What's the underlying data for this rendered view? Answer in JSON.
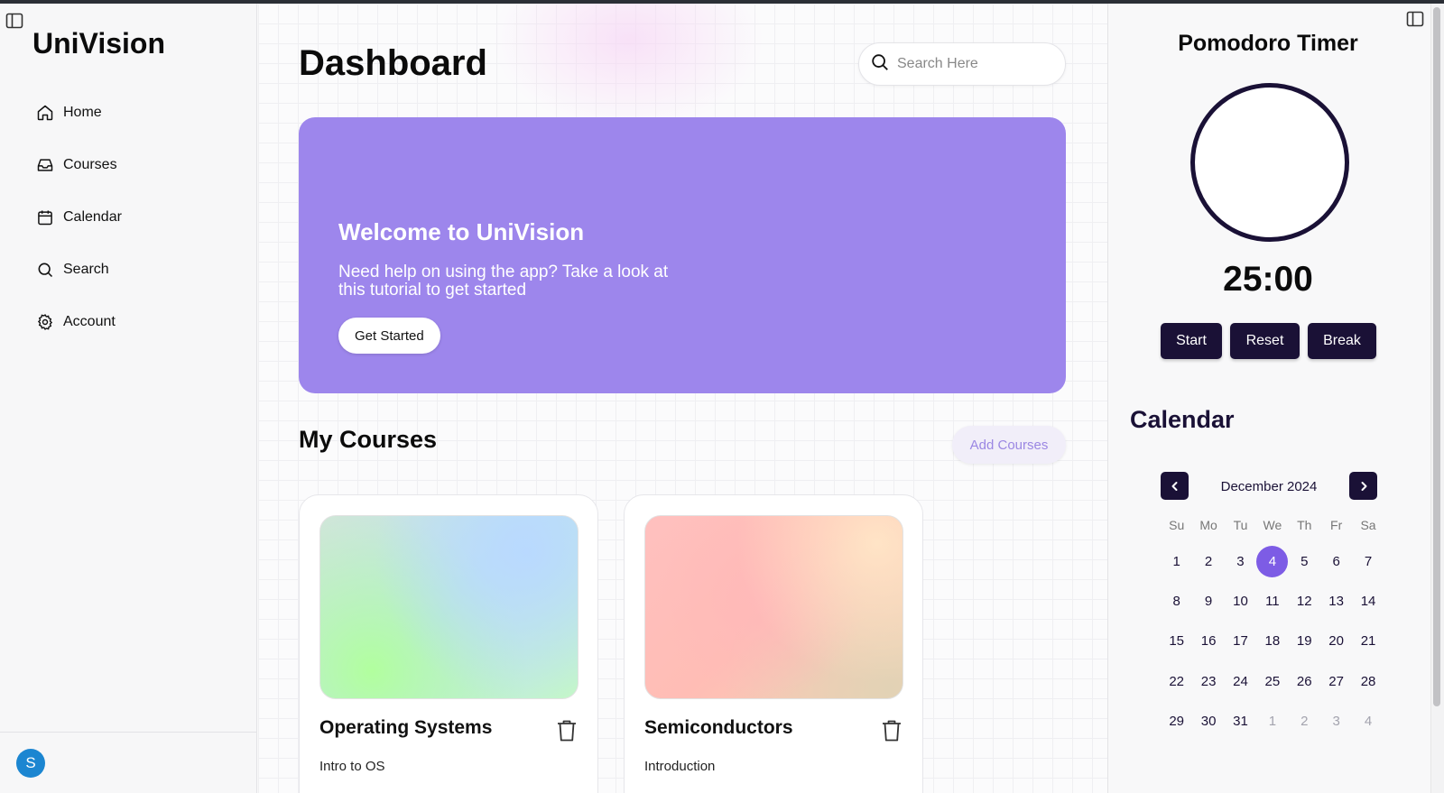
{
  "app": {
    "brand": "UniVision"
  },
  "sidebar": {
    "items": [
      {
        "label": "Home",
        "icon": "home-icon"
      },
      {
        "label": "Courses",
        "icon": "inbox-icon"
      },
      {
        "label": "Calendar",
        "icon": "calendar-icon"
      },
      {
        "label": "Search",
        "icon": "search-icon"
      },
      {
        "label": "Account",
        "icon": "gear-icon"
      }
    ],
    "user_initial": "S"
  },
  "main": {
    "title": "Dashboard",
    "search_placeholder": "Search Here",
    "banner": {
      "title": "Welcome to UniVision",
      "text": "Need help on using the app? Take a look at this tutorial to get started",
      "button": "Get Started"
    },
    "courses_title": "My Courses",
    "add_courses": "Add Courses",
    "courses": [
      {
        "name": "Operating Systems",
        "subtitle": "Intro to OS"
      },
      {
        "name": "Semiconductors",
        "subtitle": "Introduction"
      }
    ]
  },
  "right": {
    "pomodoro": {
      "title": "Pomodoro Timer",
      "time": "25:00",
      "buttons": {
        "start": "Start",
        "reset": "Reset",
        "break": "Break"
      }
    },
    "calendar": {
      "title": "Calendar",
      "month": "December 2024",
      "weekdays": [
        "Su",
        "Mo",
        "Tu",
        "We",
        "Th",
        "Fr",
        "Sa"
      ],
      "weeks": [
        [
          "1",
          "2",
          "3",
          "4",
          "5",
          "6",
          "7"
        ],
        [
          "8",
          "9",
          "10",
          "11",
          "12",
          "13",
          "14"
        ],
        [
          "15",
          "16",
          "17",
          "18",
          "19",
          "20",
          "21"
        ],
        [
          "22",
          "23",
          "24",
          "25",
          "26",
          "27",
          "28"
        ],
        [
          "29",
          "30",
          "31",
          "1",
          "2",
          "3",
          "4"
        ]
      ],
      "today": "4",
      "accent": "#7d5ce5"
    }
  },
  "colors": {
    "banner": "#9d86ec",
    "dark": "#1a1136",
    "avatar": "#1c86d1"
  }
}
